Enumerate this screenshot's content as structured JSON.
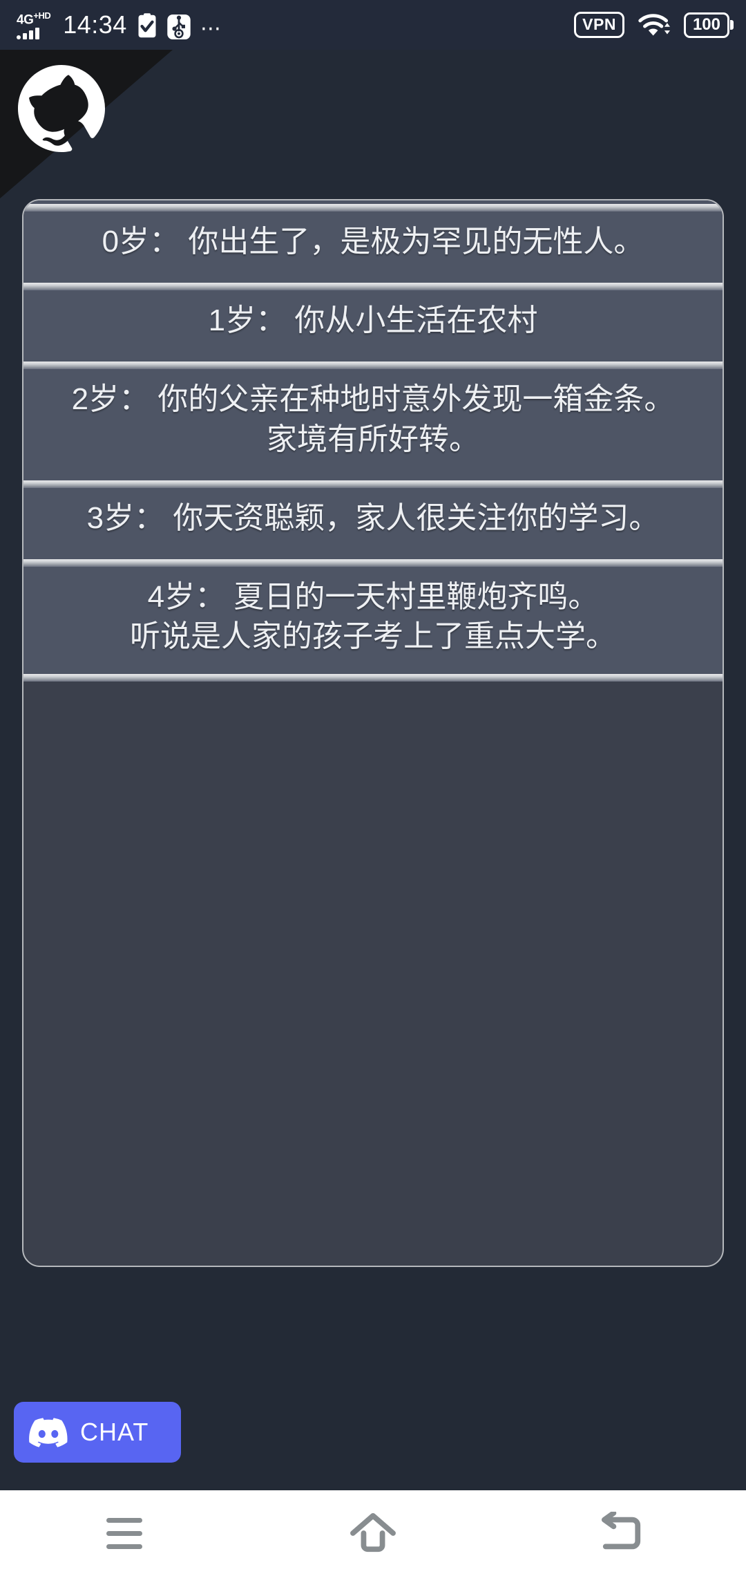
{
  "status_bar": {
    "network_label": "4G",
    "network_sup": "+HD",
    "time": "14:34",
    "icons": [
      "clipboard-check-icon",
      "usb-settings-icon",
      "overflow-dots-icon"
    ],
    "overflow": "⋯",
    "vpn_label": "VPN",
    "wifi_label": "wifi-icon",
    "battery_level": "100",
    "background_color": "#232a3a"
  },
  "github_corner": {
    "icon": "octocat-icon",
    "ribbon_color": "#161719"
  },
  "page": {
    "background_color": "#232a36",
    "panel_color": "#3b404c",
    "card_color": "#4e5565",
    "accent_color": "#5865f2",
    "border_color": "#b6b9bd"
  },
  "life_log": {
    "entries": [
      {
        "age": "0岁：",
        "text": "0岁： 你出生了，是极为罕见的无性人。"
      },
      {
        "age": "1岁：",
        "text": "1岁： 你从小生活在农村"
      },
      {
        "age": "2岁：",
        "text": "2岁： 你的父亲在种地时意外发现一箱金条。\n家境有所好转。"
      },
      {
        "age": "3岁：",
        "text": "3岁： 你天资聪颖，家人很关注你的学习。"
      },
      {
        "age": "4岁：",
        "text": "4岁： 夏日的一天村里鞭炮齐鸣。\n听说是人家的孩子考上了重点大学。"
      }
    ]
  },
  "chat_button": {
    "label": "CHAT",
    "icon": "discord-icon"
  },
  "nav_bar": {
    "buttons": [
      {
        "name": "recents",
        "icon": "hamburger-icon"
      },
      {
        "name": "home",
        "icon": "home-icon"
      },
      {
        "name": "back",
        "icon": "back-arrow-icon"
      }
    ]
  }
}
